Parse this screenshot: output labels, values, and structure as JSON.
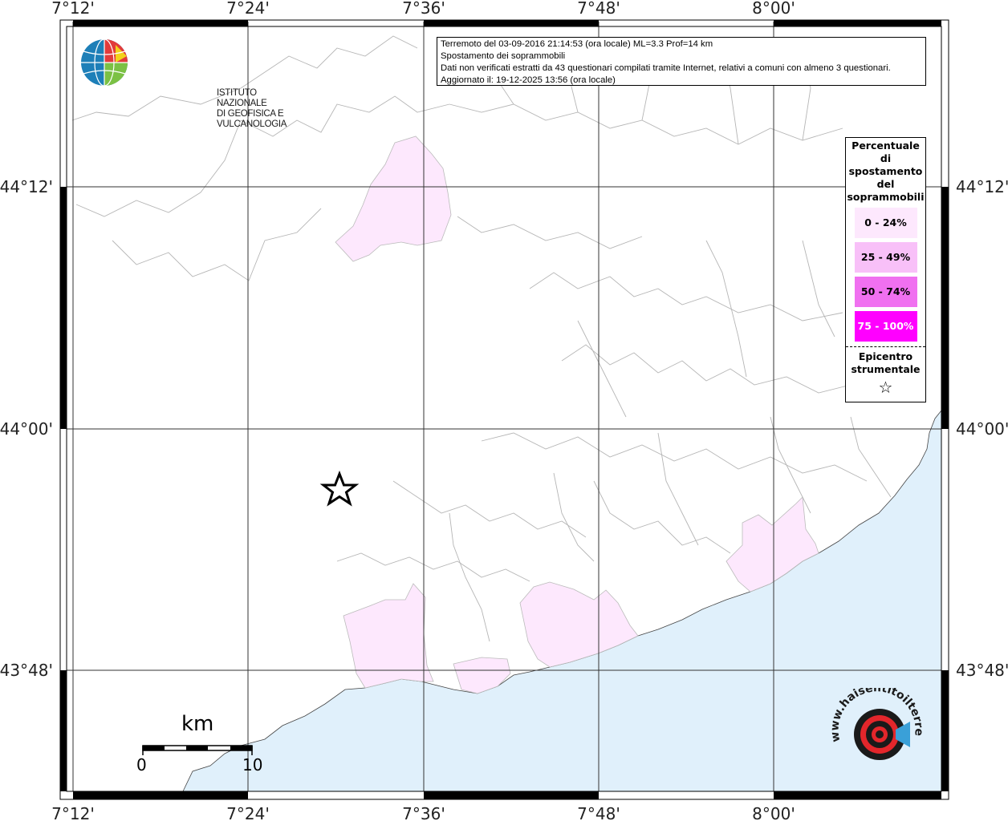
{
  "title_box": {
    "line1": "Terremoto del 03-09-2016 21:14:53 (ora locale) ML=3.3 Prof=14 km",
    "line2": "Spostamento dei soprammobili",
    "line3": "Dati non verificati estratti da 43 questionari compilati tramite Internet, relativi a comuni con almeno 3 questionari.",
    "line4": "Aggiornato il: 19-12-2025 13:56 (ora locale)"
  },
  "logo": {
    "line1": "ISTITUTO NAZIONALE",
    "line2": "DI GEOFISICA E VULCANOLOGIA"
  },
  "axes": {
    "top_labels": [
      "7°12'",
      "7°24'",
      "7°36'",
      "7°48'",
      "8°00'"
    ],
    "bottom_labels": [
      "7°12'",
      "7°24'",
      "7°36'",
      "7°48'",
      "8°00'"
    ],
    "left_labels": [
      "44°12'",
      "44°00'",
      "43°48'"
    ],
    "right_labels": [
      "44°12'",
      "44°00'",
      "43°48'"
    ]
  },
  "legend": {
    "title": [
      "Percentuale",
      "di",
      "spostamento",
      "del",
      "soprammobili"
    ],
    "items": [
      {
        "label": "0 - 24%",
        "color": "#fde8fd",
        "text_color": "#000000"
      },
      {
        "label": "25 - 49%",
        "color": "#f8c0f8",
        "text_color": "#000000"
      },
      {
        "label": "50 - 74%",
        "color": "#f070f0",
        "text_color": "#000000"
      },
      {
        "label": "75 - 100%",
        "color": "#ff00ff",
        "text_color": "#ffffff"
      }
    ],
    "epicenter_label": [
      "Epicentro",
      "strumentale"
    ],
    "epicenter_symbol": "☆"
  },
  "scale": {
    "unit": "km",
    "min": "0",
    "max": "10"
  },
  "hsit_logo": {
    "text": "www.haisentitoilterremoto.it"
  },
  "colors": {
    "sea": "#e0f0fb",
    "land": "#ffffff",
    "highlight": "#fde8fd",
    "frame": "#000000"
  }
}
